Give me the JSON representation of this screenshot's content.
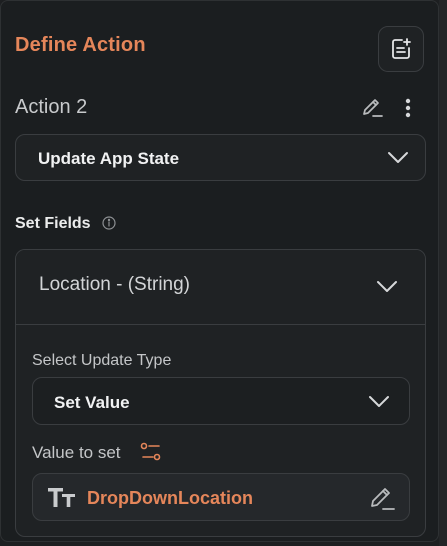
{
  "header": {
    "title": "Define Action",
    "add_note_icon": "note-add-icon"
  },
  "action": {
    "name": "Action 2",
    "edit_icon": "pencil-icon",
    "more_icon": "more-vertical-icon",
    "type_selected": "Update App State"
  },
  "set_fields": {
    "label": "Set Fields",
    "info_icon": "info-icon",
    "field": {
      "label": "Location - (String)",
      "update_type_label": "Select Update Type",
      "update_type_selected": "Set Value",
      "value_label": "Value to set",
      "value_icon": "tune-icon",
      "value": "DropDownLocation"
    }
  },
  "colors": {
    "accent": "#e5865a",
    "background": "#1b1e20",
    "border": "#3a3d40"
  }
}
